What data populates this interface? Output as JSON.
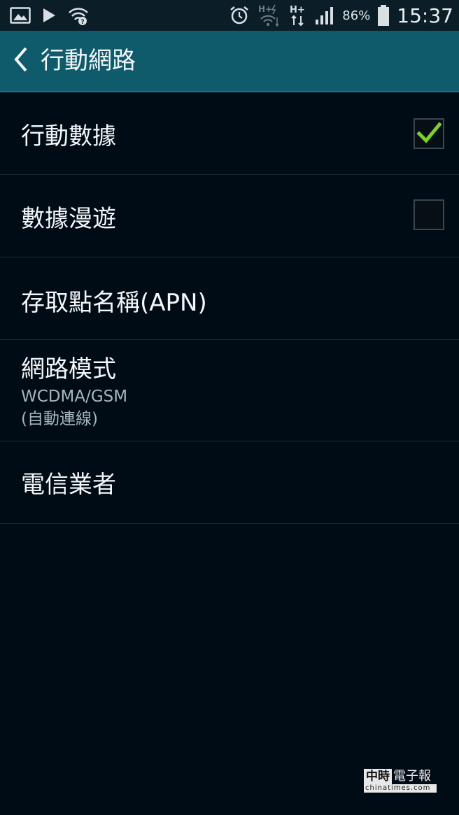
{
  "status_bar": {
    "battery_percent": "86%",
    "time": "15:37",
    "left_icons": [
      "image-icon",
      "play-icon",
      "wifi-question-icon"
    ],
    "right_icons": [
      "alarm-icon",
      "hplus-wifi-icon",
      "hplus-data-icon",
      "signal-icon",
      "battery-icon"
    ]
  },
  "app_bar": {
    "title": "行動網路",
    "background": "#0f5b6c"
  },
  "settings": {
    "mobile_data": {
      "title": "行動數據",
      "checked": true
    },
    "data_roaming": {
      "title": "數據漫遊",
      "checked": false
    },
    "apn": {
      "title": "存取點名稱(APN)"
    },
    "network_mode": {
      "title": "網路模式",
      "value_line1": "WCDMA/GSM",
      "value_line2": "(自動連線)"
    },
    "carrier": {
      "title": "電信業者"
    }
  },
  "watermark": {
    "box": "中時",
    "name": "電子報",
    "url": "chinatimes.com"
  },
  "colors": {
    "background": "#000c15",
    "accent_check": "#7ed321",
    "divider": "#1a2a35"
  }
}
